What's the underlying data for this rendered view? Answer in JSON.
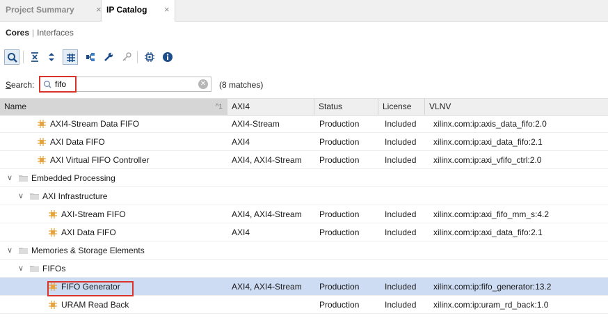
{
  "tabs": [
    {
      "label": "Project Summary",
      "close": "×"
    },
    {
      "label": "IP Catalog",
      "close": "×"
    }
  ],
  "subnav": {
    "current": "Cores",
    "separator": "|",
    "other": "Interfaces"
  },
  "toolbar": {
    "icons": [
      "search-icon",
      "collapse-all-icon",
      "expand-all-icon",
      "hierarchy-filter-icon",
      "connect-icon",
      "wrench-icon",
      "key-icon",
      "chip-icon",
      "info-icon"
    ]
  },
  "search": {
    "label_prefix": "S",
    "label_rest": "earch:",
    "value": "fifo",
    "matches": "(8 matches)"
  },
  "columns": {
    "name": "Name",
    "sort": "^1",
    "axi4": "AXI4",
    "status": "Status",
    "license": "License",
    "vlnv": "VLNV"
  },
  "rows": [
    {
      "name": "AXI4-Stream Data FIFO",
      "axi4": "AXI4-Stream",
      "status": "Production",
      "license": "Included",
      "vlnv": "xilinx.com:ip:axis_data_fifo:2.0"
    },
    {
      "name": "AXI Data FIFO",
      "axi4": "AXI4",
      "status": "Production",
      "license": "Included",
      "vlnv": "xilinx.com:ip:axi_data_fifo:2.1"
    },
    {
      "name": "AXI Virtual FIFO Controller",
      "axi4": "AXI4, AXI4-Stream",
      "status": "Production",
      "license": "Included",
      "vlnv": "xilinx.com:ip:axi_vfifo_ctrl:2.0"
    },
    {
      "name": "Embedded Processing"
    },
    {
      "name": "AXI Infrastructure"
    },
    {
      "name": "AXI-Stream FIFO",
      "axi4": "AXI4, AXI4-Stream",
      "status": "Production",
      "license": "Included",
      "vlnv": "xilinx.com:ip:axi_fifo_mm_s:4.2"
    },
    {
      "name": "AXI Data FIFO",
      "axi4": "AXI4",
      "status": "Production",
      "license": "Included",
      "vlnv": "xilinx.com:ip:axi_data_fifo:2.1"
    },
    {
      "name": "Memories & Storage Elements"
    },
    {
      "name": "FIFOs"
    },
    {
      "name": "FIFO Generator",
      "axi4": "AXI4, AXI4-Stream",
      "status": "Production",
      "license": "Included",
      "vlnv": "xilinx.com:ip:fifo_generator:13.2"
    },
    {
      "name": "URAM Read Back",
      "axi4": "",
      "status": "Production",
      "license": "Included",
      "vlnv": "xilinx.com:ip:uram_rd_back:1.0"
    }
  ],
  "colors": {
    "selected_row": "#cddcf3",
    "highlight": "#d9342b",
    "ip_icon": "#e8a43a"
  }
}
